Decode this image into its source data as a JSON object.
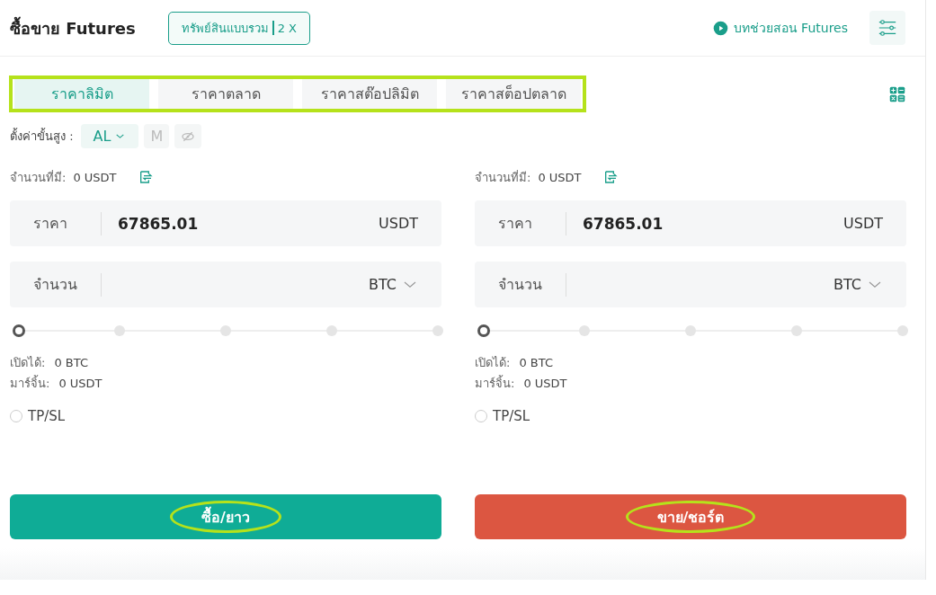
{
  "header": {
    "title": "ซื้อขาย Futures",
    "mode_badge": {
      "label": "ทรัพย์สินแบบรวม",
      "leverage": "2 X"
    },
    "tutorial_link": "บทช่วยสอน Futures"
  },
  "order_tabs": [
    {
      "label": "ราคาลิมิต",
      "selected": true
    },
    {
      "label": "ราคาตลาด",
      "selected": false
    },
    {
      "label": "ราคาสต๊อปลิมิต",
      "selected": false
    },
    {
      "label": "ราคาสต็อปตลาด",
      "selected": false
    }
  ],
  "settings": {
    "label": "ตั้งค่าขั้นสูง :",
    "buttons": [
      {
        "kind": "dropdown",
        "label": "AL",
        "active": true
      },
      {
        "kind": "text",
        "label": "M",
        "active": false
      },
      {
        "kind": "eye",
        "active": false
      }
    ]
  },
  "panels": [
    {
      "available_label": "จำนวนที่มี:",
      "available_value": "0 USDT",
      "price": {
        "label": "ราคา",
        "value": "67865.01",
        "unit": "USDT"
      },
      "amount": {
        "label": "จำนวน",
        "unit": "BTC"
      },
      "slider": {
        "level": 0
      },
      "stats": [
        {
          "label": "เปิดได้:",
          "value": "0 BTC"
        },
        {
          "label": "มาร์จิ้น:",
          "value": "0 USDT"
        }
      ],
      "tpsl": {
        "label": "TP/SL",
        "checked": false
      },
      "submit": {
        "kind": "buy",
        "label": "ซื้อ/ยาว"
      }
    },
    {
      "available_label": "จำนวนที่มี:",
      "available_value": "0 USDT",
      "price": {
        "label": "ราคา",
        "value": "67865.01",
        "unit": "USDT"
      },
      "amount": {
        "label": "จำนวน",
        "unit": "BTC"
      },
      "slider": {
        "level": 0
      },
      "stats": [
        {
          "label": "เปิดได้:",
          "value": "0 BTC"
        },
        {
          "label": "มาร์จิ้น:",
          "value": "0 USDT"
        }
      ],
      "tpsl": {
        "label": "TP/SL",
        "checked": false
      },
      "submit": {
        "kind": "sell",
        "label": "ขาย/ชอร์ต"
      }
    }
  ]
}
